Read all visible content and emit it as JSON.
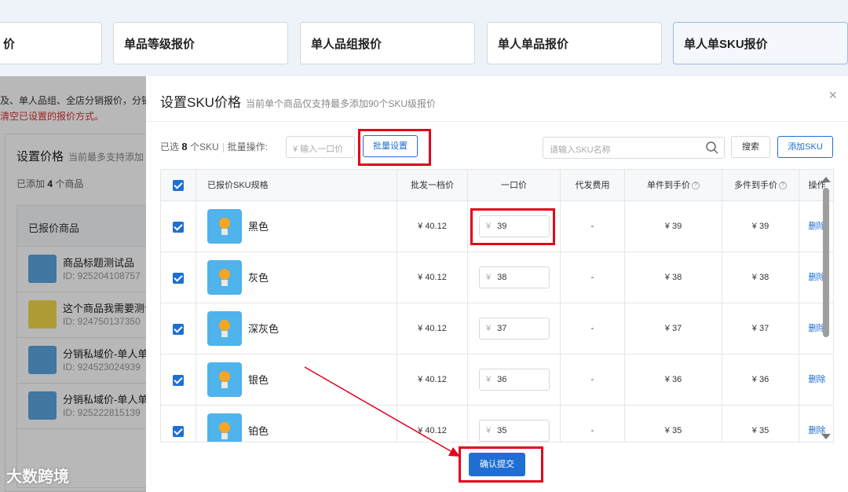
{
  "tabs": [
    {
      "label": "价"
    },
    {
      "label": "单品等级报价"
    },
    {
      "label": "单人品组报价"
    },
    {
      "label": "单人单品报价"
    },
    {
      "label": "单人单SKU报价"
    }
  ],
  "background": {
    "note_line1": "及、单人品组、全店分销报价，分销",
    "note_line2": "清空已设置的报价方式。",
    "card_title": "设置价格",
    "card_subtitle": "当前最多支持添加",
    "added_prefix": "已添加",
    "added_count": "4",
    "added_suffix": "个商品",
    "table_header": "已报价商品",
    "products": [
      {
        "name": "商品标题测试品",
        "id": "ID: 925204108757"
      },
      {
        "name": "这个商品我需要测试",
        "id": "ID: 924750137350"
      },
      {
        "name": "分销私域价-单人单",
        "id": "ID: 924523024939"
      },
      {
        "name": "分销私域价-单人单",
        "id": "ID: 925222815139"
      }
    ]
  },
  "modal": {
    "title": "设置SKU价格",
    "subtitle": "当前单个商品仅支持最多添加90个SKU级报价",
    "close_icon": "×",
    "selected_prefix": "已选",
    "selected_count": "8",
    "selected_suffix": "个SKU",
    "batch_label": "批量操作:",
    "batch_placeholder": "¥  输入一口价",
    "batch_button": "批量设置",
    "search_placeholder": "请输入SKU名称",
    "search_button": "搜索",
    "add_button": "添加SKU",
    "columns": {
      "spec": "已报价SKU规格",
      "wholesale": "批发一档价",
      "fixed": "一口价",
      "agent_fee": "代发费用",
      "single_price": "单件到手价",
      "multi_price": "多件到手价",
      "action": "操作"
    },
    "currency_symbol": "¥",
    "rows": [
      {
        "name": "黑色",
        "wholesale": "¥ 40.12",
        "price": "39",
        "fee": "-",
        "single": "¥ 39",
        "multi": "¥ 39",
        "action": "删除"
      },
      {
        "name": "灰色",
        "wholesale": "¥ 40.12",
        "price": "38",
        "fee": "-",
        "single": "¥ 38",
        "multi": "¥ 38",
        "action": "删除"
      },
      {
        "name": "深灰色",
        "wholesale": "¥ 40.12",
        "price": "37",
        "fee": "-",
        "single": "¥ 37",
        "multi": "¥ 37",
        "action": "删除"
      },
      {
        "name": "银色",
        "wholesale": "¥ 40.12",
        "price": "36",
        "fee": "-",
        "single": "¥ 36",
        "multi": "¥ 36",
        "action": "删除"
      },
      {
        "name": "铂色",
        "wholesale": "¥ 40.12",
        "price": "35",
        "fee": "-",
        "single": "¥ 35",
        "multi": "¥ 35",
        "action": "删除"
      }
    ],
    "confirm_button": "确认提交"
  },
  "watermark": "大数跨境",
  "colors": {
    "accent": "#1f6fd2",
    "annotation": "#e3001b",
    "warning_text": "#e03030"
  }
}
